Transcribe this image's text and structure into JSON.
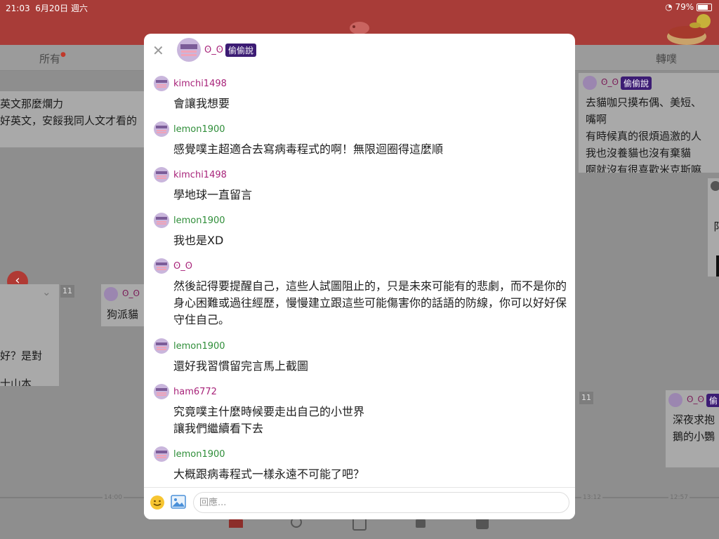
{
  "status_bar": {
    "time": "21:03",
    "date": "6月20日 週六",
    "battery": "79%"
  },
  "tabs": [
    {
      "label": "所有"
    },
    {
      "label": "轉噗"
    }
  ],
  "background_cards": {
    "left_top": {
      "lines": [
        "英文那麼爛力",
        "好英文，安餒我同人文才看的"
      ]
    },
    "left_mid": {
      "lines": [
        "好？是對",
        "士山本"
      ],
      "count": "11"
    },
    "mid_left": {
      "name": "ʘ_ʘ",
      "text": "狗派貓"
    },
    "right_top": {
      "name": "ʘ_ʘ",
      "badge": "偷偷說",
      "lines": [
        "去貓咖只摸布偶、美短、",
        "嘴啊",
        "有時候真的很煩過激的人",
        "我也沒養貓也沒有棄貓",
        "啊就沒有很喜歡米克斯嘛"
      ]
    },
    "right_mid": {
      "count": "11",
      "name": "ʘ_ʘ",
      "badge": "偷",
      "lines": [
        "深夜求抱",
        "鵝的小鸚"
      ]
    },
    "right_edge": {
      "letter": "阝"
    }
  },
  "timeline_labels": [
    "14:00",
    "13:12",
    "12:57"
  ],
  "modal": {
    "close_symbol": "✕",
    "owner_name": "ʘ_ʘ",
    "owner_badge": "偷偷說",
    "comments": [
      {
        "user": "kimchi1498",
        "color": "purple",
        "text": "會讓我想要"
      },
      {
        "user": "lemon1900",
        "color": "green",
        "text": "感覺噗主超適合去寫病毒程式的啊！無限迴圈得這麼順"
      },
      {
        "user": "kimchi1498",
        "color": "purple",
        "text": "學地球一直留言"
      },
      {
        "user": "lemon1900",
        "color": "green",
        "text": "我也是XD"
      },
      {
        "user": "ʘ_ʘ",
        "color": "purple",
        "text": "然後記得要提醒自己，這些人試圖阻止的，只是未來可能有的悲劇，而不是你的身心困難或過往經歷，慢慢建立跟這些可能傷害你的話語的防線，你可以好好保守住自己。"
      },
      {
        "user": "lemon1900",
        "color": "green",
        "text": "還好我習慣留完言馬上截圖"
      },
      {
        "user": "ham6772",
        "color": "purple",
        "text": "究竟噗主什麼時候要走出自己的小世界\n讓我們繼續看下去"
      },
      {
        "user": "lemon1900",
        "color": "green",
        "text": "大概跟病毒程式一樣永遠不可能了吧？"
      }
    ],
    "reply_placeholder": "回應..."
  }
}
